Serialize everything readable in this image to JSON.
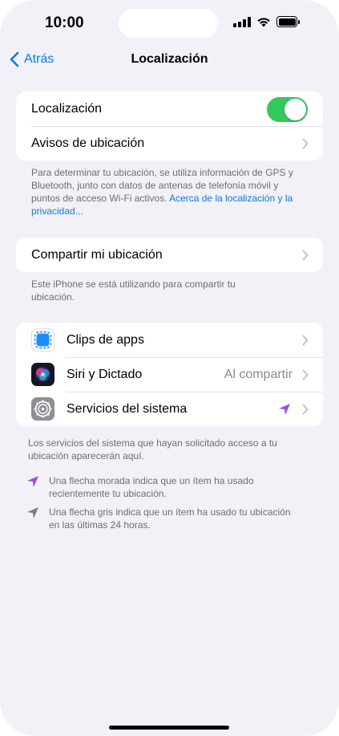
{
  "status": {
    "time": "10:00"
  },
  "nav": {
    "back_label": "Atrás",
    "title": "Localización"
  },
  "location_group": {
    "toggle_label": "Localización",
    "toggle_on": true,
    "alerts_label": "Avisos de ubicación"
  },
  "location_footnote": {
    "text": "Para determinar tu ubicación, se utiliza información de GPS y Bluetooth, junto con datos de antenas de telefonía móvil y puntos de acceso Wi-Fi activos.",
    "link": "Acerca de la localización y la privacidad..."
  },
  "share": {
    "label": "Compartir mi ubicación",
    "footnote": "Este iPhone se está utilizando para compartir tu ubicación."
  },
  "apps": [
    {
      "label": "Clips de apps",
      "icon": "app-clips-icon"
    },
    {
      "label": "Siri y Dictado",
      "value": "Al compartir",
      "icon": "siri-icon"
    },
    {
      "label": "Servicios del sistema",
      "icon": "settings-gear-icon",
      "arrow": "purple"
    }
  ],
  "apps_footnote": "Los servicios del sistema que hayan solicitado acceso a tu ubicación aparecerán aquí.",
  "legend": [
    {
      "text": "Una flecha morada indica que un ítem ha usado recientemente tu ubicación.",
      "color": "#a24be0"
    },
    {
      "text": "Una flecha gris indica que un ítem ha usado tu ubicación en las últimas 24 horas.",
      "color": "#7c7c80"
    }
  ],
  "colors": {
    "accent": "#0a7aff",
    "toggle_on": "#34c759",
    "purple_arrow": "#a24be0",
    "gray_arrow": "#7c7c80"
  }
}
